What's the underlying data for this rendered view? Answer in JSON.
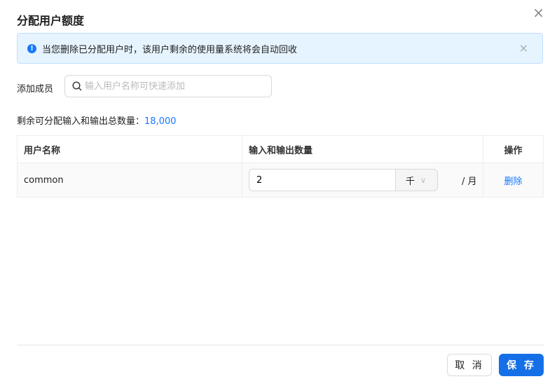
{
  "dialog": {
    "title": "分配用户额度",
    "close_icon": "×"
  },
  "alert": {
    "text": "当您删除已分配用户时，该用户剩余的使用量系统将会自动回收",
    "icon": "!",
    "close": "×"
  },
  "add_member": {
    "label": "添加成员",
    "placeholder": "输入用户名称可快速添加"
  },
  "remaining": {
    "label": "剩余可分配输入和输出总数量：",
    "value": "18,000"
  },
  "table": {
    "headers": [
      "用户名称",
      "输入和输出数量",
      "操作"
    ],
    "rows": [
      {
        "name": "common",
        "amount": "2",
        "unit": "千",
        "period": "/ 月",
        "action": "删除"
      }
    ]
  },
  "footer": {
    "cancel": "取 消",
    "save": "保 存"
  }
}
